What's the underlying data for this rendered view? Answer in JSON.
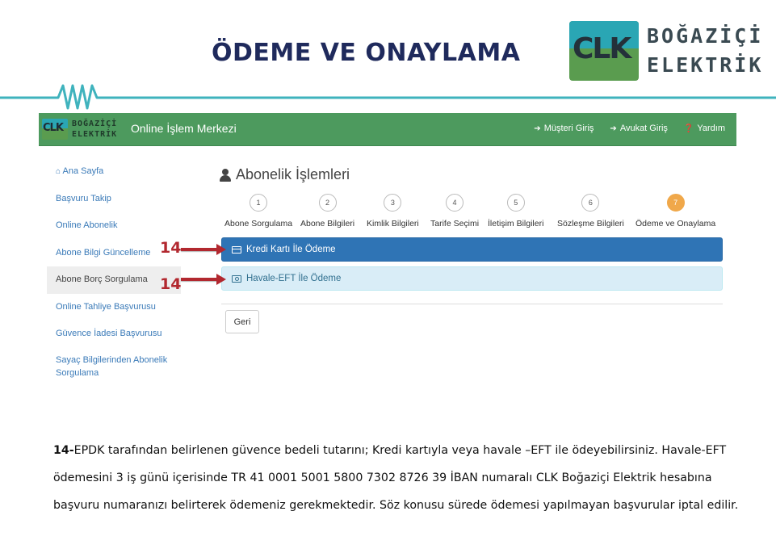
{
  "slide": {
    "title": "ÖDEME VE ONAYLAMA",
    "brand": {
      "mark": "CLK",
      "name_line1": "BOĞAZİÇİ",
      "name_line2": "ELEKTRİK"
    }
  },
  "navbar": {
    "logo_mark": "CLK",
    "logo_line1": "BOĞAZİÇİ",
    "logo_line2": "ELEKTRİK",
    "title": "Online İşlem Merkezi",
    "links": [
      {
        "label": "Müşteri Giriş",
        "icon": "sign-in-icon"
      },
      {
        "label": "Avukat Giriş",
        "icon": "sign-in-icon"
      },
      {
        "label": "Yardım",
        "icon": "question-circle-icon"
      }
    ]
  },
  "sidebar": {
    "items": [
      {
        "label": "Ana Sayfa",
        "icon": "home-icon"
      },
      {
        "label": "Başvuru Takip"
      },
      {
        "label": "Online Abonelik"
      },
      {
        "label": "Abone Bilgi Güncelleme"
      },
      {
        "label": "Abone Borç Sorgulama",
        "active": true
      },
      {
        "label": "Online Tahliye Başvurusu"
      },
      {
        "label": "Güvence İadesi Başvurusu"
      },
      {
        "label": "Sayaç Bilgilerinden Abonelik Sorgulama"
      }
    ]
  },
  "main": {
    "heading": "Abonelik İşlemleri",
    "steps": [
      {
        "number": "1",
        "label": "Abone Sorgulama"
      },
      {
        "number": "2",
        "label": "Abone Bilgileri"
      },
      {
        "number": "3",
        "label": "Kimlik Bilgileri"
      },
      {
        "number": "4",
        "label": "Tarife Seçimi"
      },
      {
        "number": "5",
        "label": "İletişim Bilgileri"
      },
      {
        "number": "6",
        "label": "Sözleşme Bilgileri"
      },
      {
        "number": "7",
        "label": "Ödeme ve Onaylama",
        "current": true
      }
    ],
    "pay_card_label": "Kredi Kartı İle Ödeme",
    "pay_eft_label": "Havale-EFT İle Ödeme",
    "back_label": "Geri"
  },
  "annotations": {
    "marker_1": "14",
    "marker_2": "14",
    "color": "#b2282f"
  },
  "description": {
    "number": "14-",
    "text": "EPDK tarafından belirlenen güvence bedeli tutarını; Kredi kartıyla veya havale –EFT ile  ödeyebilirsiniz. Havale-EFT ödemesini 3 iş günü içerisinde TR 41 0001 5001 5800 7302 8726 39 İBAN numaralı CLK Boğaziçi Elektrik hesabına başvuru numaranızı belirterek ödemeniz gerekmektedir. Söz konusu sürede ödemesi yapılmayan başvurular iptal edilir."
  },
  "colors": {
    "title": "#1f2a5c",
    "navbar": "#4d9a5e",
    "primary": "#2f74b5",
    "info_bg": "#d9edf7",
    "step_current": "#f0a84a",
    "wave": "#3fb3bd"
  }
}
